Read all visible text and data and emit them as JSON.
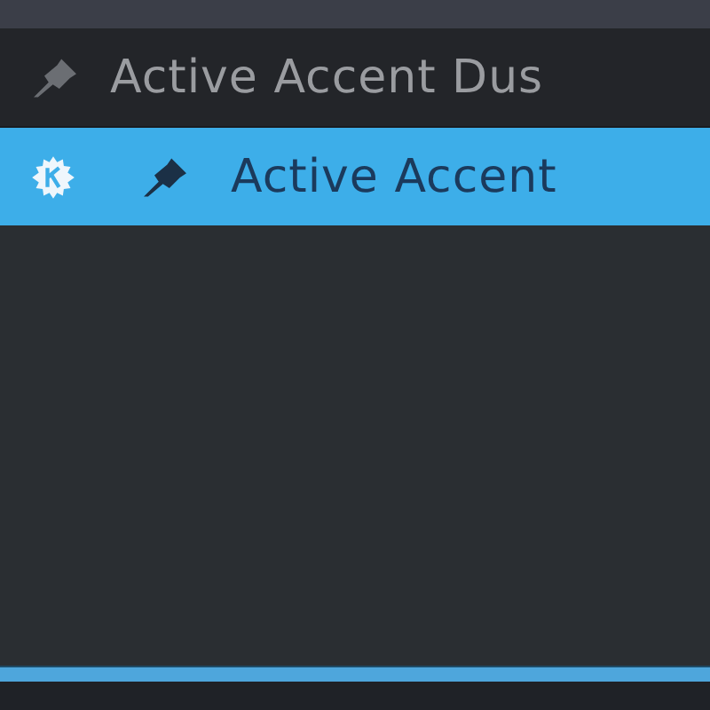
{
  "items": [
    {
      "kind": "pinned",
      "label": "Active Accent Dus",
      "selected": false
    },
    {
      "kind": "app",
      "label": "Active Accent",
      "selected": true
    }
  ]
}
